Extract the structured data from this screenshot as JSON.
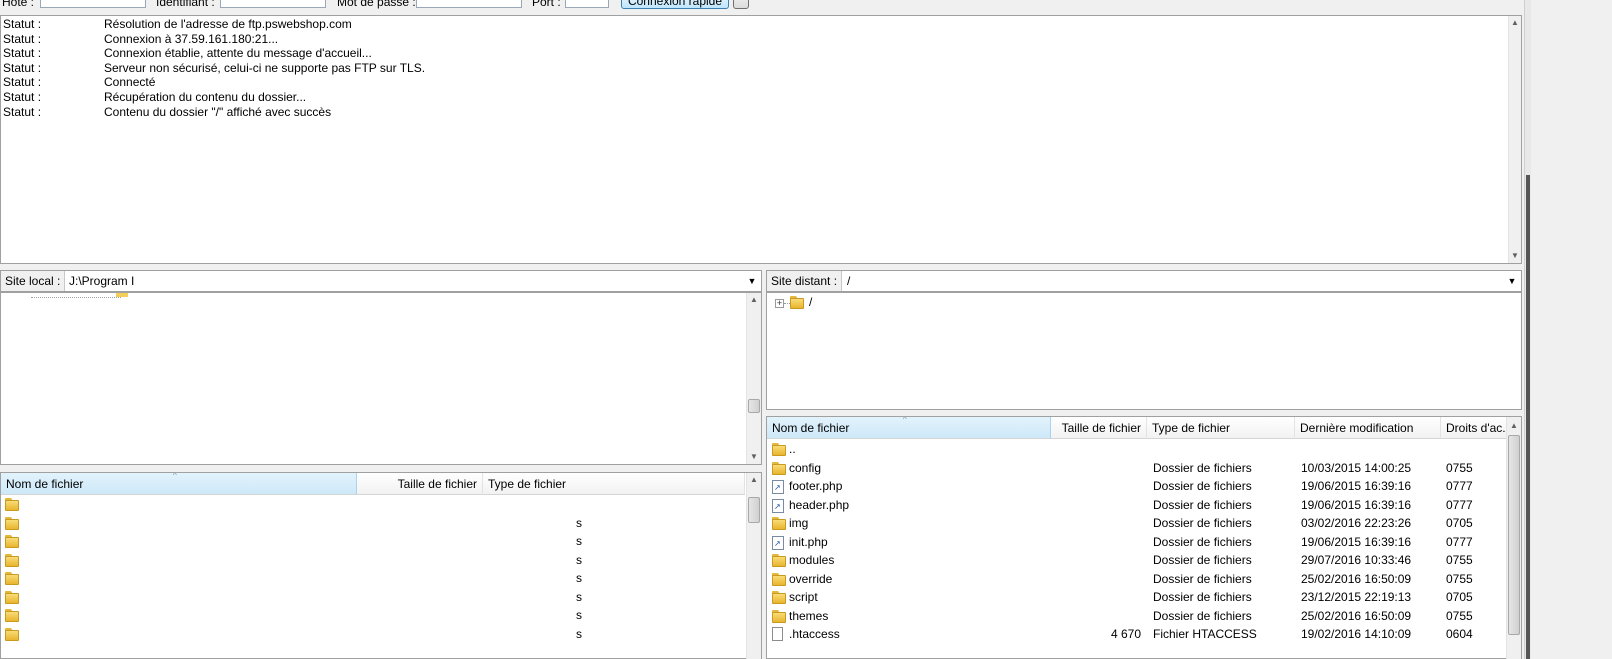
{
  "quick_connect": {
    "host_label": "Hôte :",
    "user_label": "Identifiant :",
    "pass_label": "Mot de passe :",
    "port_label": "Port :",
    "connect_label": "Connexion rapide"
  },
  "log": [
    {
      "kind": "Statut :",
      "msg": "Résolution de l'adresse de ftp.pswebshop.com"
    },
    {
      "kind": "Statut :",
      "msg": "Connexion à 37.59.161.180:21..."
    },
    {
      "kind": "Statut :",
      "msg": "Connexion établie, attente du message d'accueil..."
    },
    {
      "kind": "Statut :",
      "msg": "Serveur non sécurisé, celui-ci ne supporte pas FTP sur TLS."
    },
    {
      "kind": "Statut :",
      "msg": "Connecté"
    },
    {
      "kind": "Statut :",
      "msg": "Récupération du contenu du dossier..."
    },
    {
      "kind": "Statut :",
      "msg": "Contenu du dossier \"/\" affiché avec succès"
    }
  ],
  "local": {
    "site_label": "Site local :",
    "path": "J:\\Program I",
    "columns": [
      "Nom de fichier",
      "Taille de fichier",
      "Type de fichier"
    ],
    "rows_type_fragment": "s"
  },
  "remote": {
    "site_label": "Site distant :",
    "path": "/",
    "tree_root": "/",
    "columns": [
      "Nom de fichier",
      "Taille de fichier",
      "Type de fichier",
      "Dernière modification",
      "Droits d'ac..."
    ],
    "files": [
      {
        "name": "..",
        "icon": "folder-icon",
        "size": "",
        "type": "",
        "modified": "",
        "perms": ""
      },
      {
        "name": "config",
        "icon": "folder-icon",
        "size": "",
        "type": "Dossier de fichiers",
        "modified": "10/03/2015 14:00:25",
        "perms": "0755"
      },
      {
        "name": "footer.php",
        "icon": "link-icon",
        "size": "",
        "type": "Dossier de fichiers",
        "modified": "19/06/2015 16:39:16",
        "perms": "0777"
      },
      {
        "name": "header.php",
        "icon": "link-icon",
        "size": "",
        "type": "Dossier de fichiers",
        "modified": "19/06/2015 16:39:16",
        "perms": "0777"
      },
      {
        "name": "img",
        "icon": "folder-icon",
        "size": "",
        "type": "Dossier de fichiers",
        "modified": "03/02/2016 22:23:26",
        "perms": "0705"
      },
      {
        "name": "init.php",
        "icon": "link-icon",
        "size": "",
        "type": "Dossier de fichiers",
        "modified": "19/06/2015 16:39:16",
        "perms": "0777"
      },
      {
        "name": "modules",
        "icon": "folder-icon",
        "size": "",
        "type": "Dossier de fichiers",
        "modified": "29/07/2016 10:33:46",
        "perms": "0755"
      },
      {
        "name": "override",
        "icon": "folder-icon",
        "size": "",
        "type": "Dossier de fichiers",
        "modified": "25/02/2016 16:50:09",
        "perms": "0755"
      },
      {
        "name": "script",
        "icon": "folder-icon",
        "size": "",
        "type": "Dossier de fichiers",
        "modified": "23/12/2015 22:19:13",
        "perms": "0705"
      },
      {
        "name": "themes",
        "icon": "folder-icon",
        "size": "",
        "type": "Dossier de fichiers",
        "modified": "25/02/2016 16:50:09",
        "perms": "0755"
      },
      {
        "name": ".htaccess",
        "icon": "file-icon",
        "size": "4 670",
        "type": "Fichier HTACCESS",
        "modified": "19/02/2016 14:10:09",
        "perms": "0604"
      }
    ]
  }
}
